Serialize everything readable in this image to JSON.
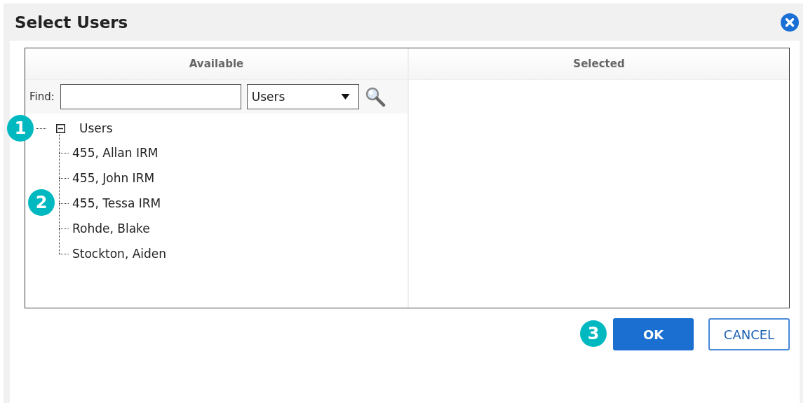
{
  "window": {
    "title": "Select Users"
  },
  "available": {
    "heading": "Available",
    "find_label": "Find:",
    "scope": "Users"
  },
  "selected": {
    "heading": "Selected"
  },
  "tree": {
    "label": "Users",
    "expanded": true,
    "callout": "1",
    "children_callout": "2",
    "children": [
      {
        "label": "455, Allan IRM"
      },
      {
        "label": "455, John IRM"
      },
      {
        "label": "455, Tessa IRM"
      },
      {
        "label": "Rohde, Blake"
      },
      {
        "label": "Stockton, Aiden"
      }
    ]
  },
  "buttons": [
    {
      "label": "OK",
      "kind": "primary",
      "callout": "3"
    },
    {
      "label": "CANCEL",
      "kind": "secondary"
    }
  ]
}
